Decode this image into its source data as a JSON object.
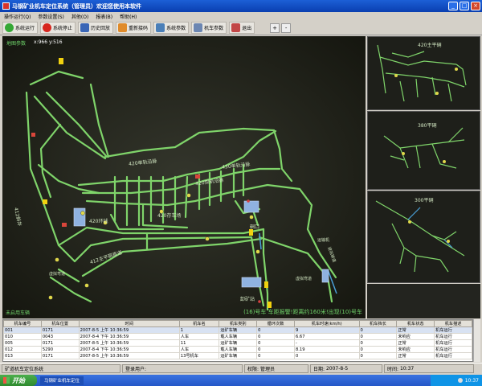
{
  "window": {
    "title": "马钢矿业机车定位系统（管理员）欢迎您使用本软件"
  },
  "menu": [
    "操作运行(Q)",
    "参数设置(S)",
    "其他(O)",
    "报表(B)",
    "帮助(H)"
  ],
  "toolbar": {
    "buttons": [
      {
        "label": "系统运行",
        "icon": "run-icon"
      },
      {
        "label": "系统停止",
        "icon": "stop-icon"
      },
      {
        "label": "历史回放",
        "icon": "history-icon"
      },
      {
        "label": "重新接码",
        "icon": "recode-icon"
      },
      {
        "label": "系统参数",
        "icon": "params-icon"
      },
      {
        "label": "机车参数",
        "icon": "loco-icon"
      },
      {
        "label": "退出",
        "icon": "exit-icon"
      }
    ],
    "zoom_in": "+",
    "zoom_out": "-"
  },
  "map": {
    "title": "地图参数",
    "coords": "x:966  y:516",
    "labels": {
      "l420_single": "420单轨沿脉",
      "l430_single": "430单轨沿脉",
      "l420_double": "420双轨沿脉",
      "l412_main": "412主平硐直道",
      "l412_vert": "412斜井",
      "l420_storage": "420存车场",
      "l420_loop": "420环线",
      "unload": "卸矿站",
      "mouth": "硐口",
      "curve1": "虚拟弯道",
      "curve2": "虚拟弯道",
      "sensor": "运输机",
      "branch": "进站坡道"
    },
    "bottom_left": "未启用车辆",
    "alarm": "(16)号车 车距报警!距离约160米!出现(10)号车"
  },
  "insets": [
    {
      "label": "420主平硐"
    },
    {
      "label": "380平硐"
    },
    {
      "label": "300平硐"
    }
  ],
  "table": {
    "headers": [
      "机车编号",
      "机车位置",
      "时间",
      "机车名",
      "机车类别",
      "循环次数",
      "机车时速(km/h)",
      "机车挡长",
      "机车状态",
      "机车描述"
    ],
    "rows": [
      [
        "001",
        "0171",
        "2007-8-5 上午 10:36:59",
        "1",
        "运矿车辆",
        "0",
        "9",
        "0",
        "正常",
        "机车运行"
      ],
      [
        "010",
        "0043",
        "2007-8-4 下午 10:36:59",
        "人车",
        "载人车辆",
        "0",
        "6.67",
        "0",
        "未响应",
        "机车运行"
      ],
      [
        "005",
        "0171",
        "2007-8-5 上午 10:36:59",
        "11",
        "运矿车辆",
        "0",
        "-",
        "0",
        "正常",
        "机车运行"
      ],
      [
        "012",
        "5290",
        "2007-8-4 下午 10:36:59",
        "人车",
        "载人车辆",
        "0",
        "8.19",
        "0",
        "未响应",
        "机车运行"
      ],
      [
        "013",
        "0171",
        "2007-8-5 上午 10:36:59",
        "13号机车",
        "运矿车辆",
        "0",
        "0",
        "0",
        "正常",
        "机车运行"
      ]
    ]
  },
  "status": {
    "app": "矿道机车定位系统",
    "user_label": "登录用户:",
    "user_value": "",
    "role_label": "权限:",
    "role_value": "管理员",
    "date_label": "日期:",
    "date_value": "2007-8-5",
    "time_label": "时间:",
    "time_value": "10:37"
  },
  "taskbar": {
    "start": "开始",
    "tasks": [
      "马钢矿业机车定位"
    ],
    "clock": "10:37"
  },
  "colors": {
    "track": "#7fd46a",
    "map_bg": "#1b1c17",
    "title_bar": "#0a3fb0",
    "alarm": "#6fd36a"
  }
}
